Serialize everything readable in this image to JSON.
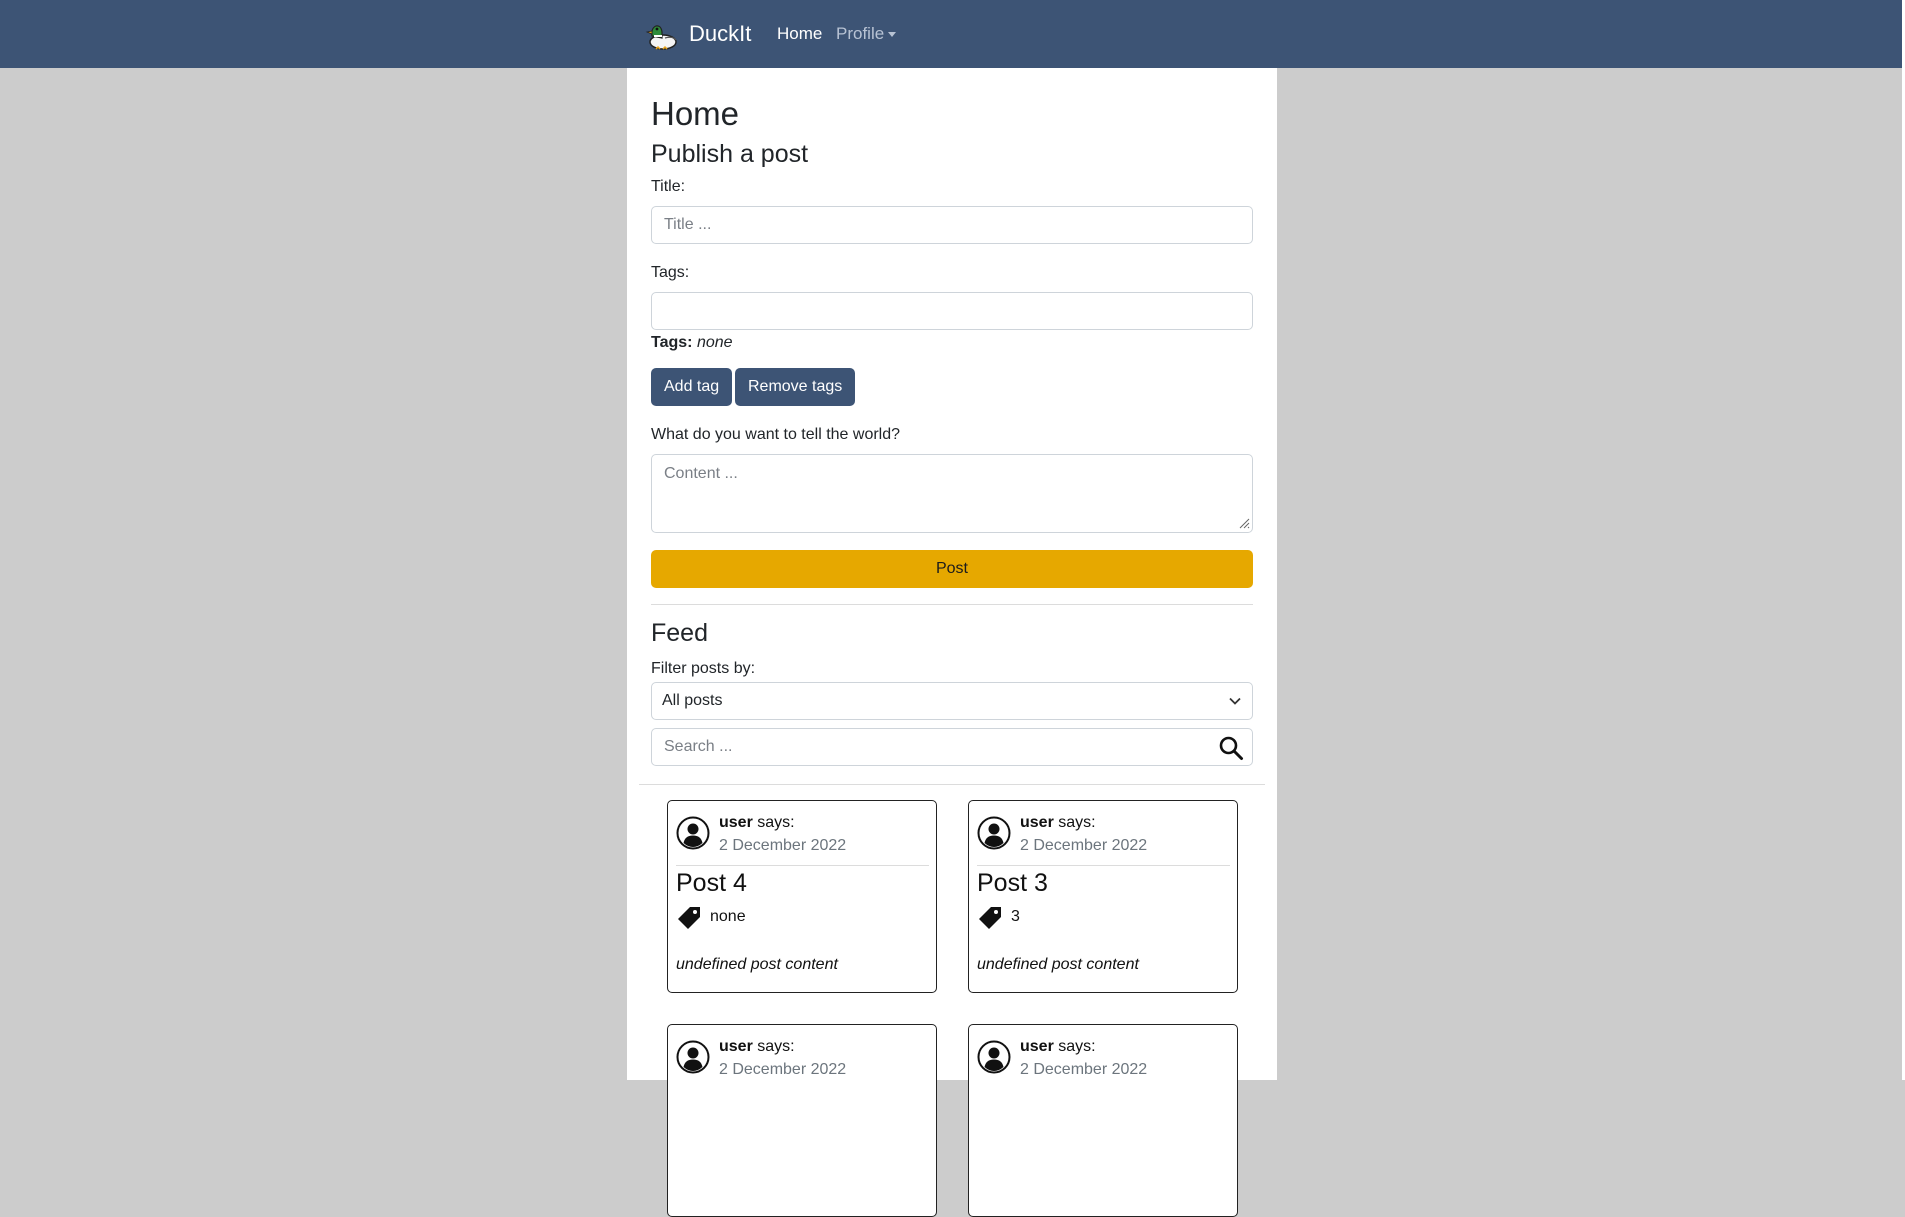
{
  "navbar": {
    "brand": "DuckIt",
    "home": "Home",
    "profile": "Profile",
    "bg_color": "#3d5475"
  },
  "page": {
    "title": "Home"
  },
  "publish": {
    "heading": "Publish a post",
    "title_label": "Title:",
    "title_placeholder": "Title ...",
    "tags_label": "Tags:",
    "tags_value": "",
    "tags_summary_label": "Tags:",
    "tags_summary_value": "none",
    "add_tag": "Add tag",
    "remove_tags": "Remove tags",
    "content_label": "What do you want to tell the world?",
    "content_placeholder": "Content ...",
    "post_button": "Post",
    "post_button_color": "#e6a800"
  },
  "feed": {
    "heading": "Feed",
    "filter_label": "Filter posts by:",
    "filter_selected": "All posts",
    "search_placeholder": "Search ...",
    "posts": [
      {
        "author": "user",
        "says": "says:",
        "date": "2 December 2022",
        "title": "Post 4",
        "tags": "none",
        "content": "undefined post content"
      },
      {
        "author": "user",
        "says": "says:",
        "date": "2 December 2022",
        "title": "Post 3",
        "tags": "3",
        "content": "undefined post content"
      },
      {
        "author": "user",
        "says": "says:",
        "date": "2 December 2022",
        "title": "",
        "tags": "",
        "content": ""
      },
      {
        "author": "user",
        "says": "says:",
        "date": "2 December 2022",
        "title": "",
        "tags": "",
        "content": ""
      }
    ]
  }
}
